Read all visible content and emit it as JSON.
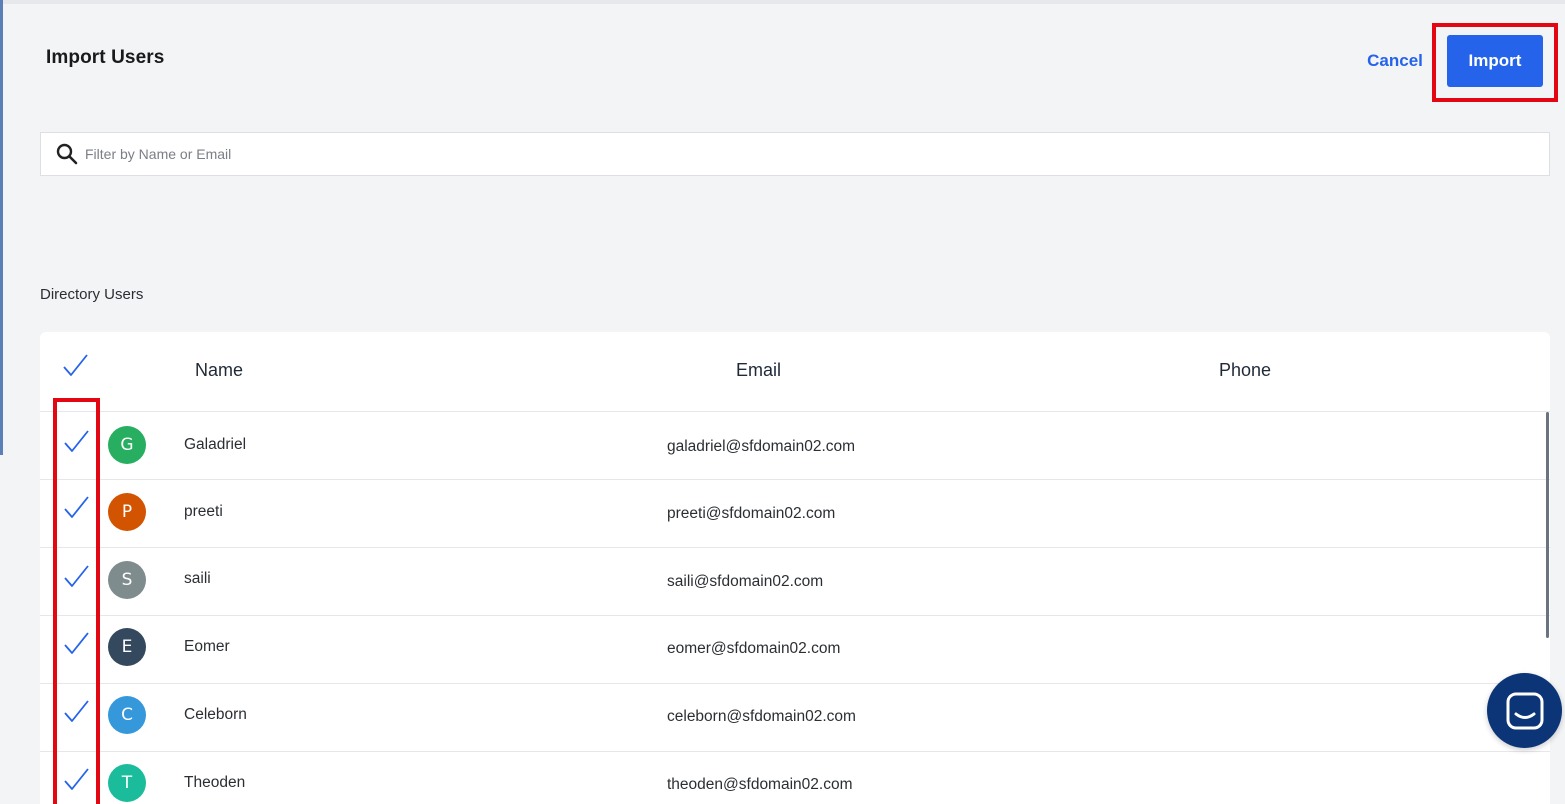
{
  "header": {
    "title": "Import Users",
    "cancel_label": "Cancel",
    "import_label": "Import"
  },
  "search": {
    "placeholder": "Filter by Name or Email"
  },
  "section": {
    "label": "Directory Users"
  },
  "table": {
    "columns": {
      "name": "Name",
      "email": "Email",
      "phone": "Phone"
    },
    "rows": [
      {
        "initial": "G",
        "name": "Galadriel",
        "email": "galadriel@sfdomain02.com",
        "phone": "",
        "color": "#27ae60",
        "selected": true
      },
      {
        "initial": "P",
        "name": "preeti",
        "email": "preeti@sfdomain02.com",
        "phone": "",
        "color": "#d35400",
        "selected": true
      },
      {
        "initial": "S",
        "name": "saili",
        "email": "saili@sfdomain02.com",
        "phone": "",
        "color": "#7f8c8d",
        "selected": true
      },
      {
        "initial": "E",
        "name": "Eomer",
        "email": "eomer@sfdomain02.com",
        "phone": "",
        "color": "#34495e",
        "selected": true
      },
      {
        "initial": "C",
        "name": "Celeborn",
        "email": "celeborn@sfdomain02.com",
        "phone": "",
        "color": "#3498db",
        "selected": true
      },
      {
        "initial": "T",
        "name": "Theoden",
        "email": "theoden@sfdomain02.com",
        "phone": "",
        "color": "#1abc9c",
        "selected": true
      }
    ]
  },
  "colors": {
    "accent": "#2563eb",
    "highlight": "#e30613",
    "chat": "#0b3577"
  },
  "icons": {
    "search": "search-icon",
    "check": "checkmark-icon",
    "chat": "chat-icon"
  }
}
